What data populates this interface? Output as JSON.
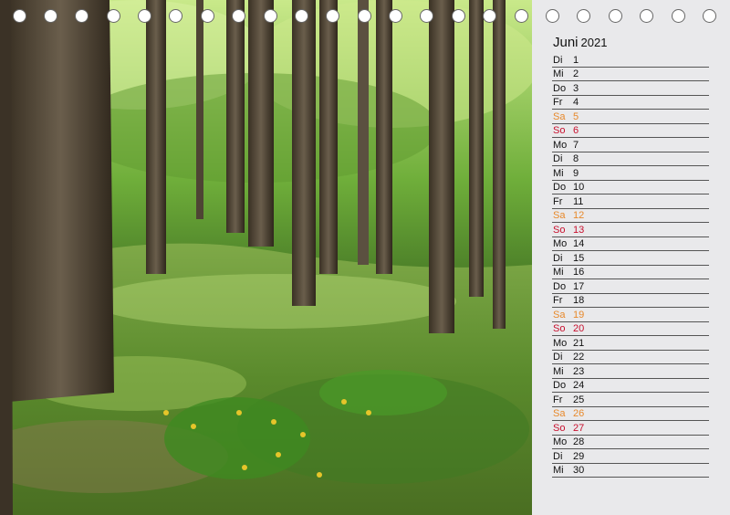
{
  "colors": {
    "saturday": "#e8892b",
    "sunday": "#c8102e",
    "panel_background": "#e9e9eb",
    "rule_line": "#555555"
  },
  "header": {
    "month": "Juni",
    "year": "2021"
  },
  "days": [
    {
      "wd": "Di",
      "n": "1",
      "type": "weekday"
    },
    {
      "wd": "Mi",
      "n": "2",
      "type": "weekday"
    },
    {
      "wd": "Do",
      "n": "3",
      "type": "weekday"
    },
    {
      "wd": "Fr",
      "n": "4",
      "type": "weekday"
    },
    {
      "wd": "Sa",
      "n": "5",
      "type": "saturday"
    },
    {
      "wd": "So",
      "n": "6",
      "type": "sunday"
    },
    {
      "wd": "Mo",
      "n": "7",
      "type": "weekday"
    },
    {
      "wd": "Di",
      "n": "8",
      "type": "weekday"
    },
    {
      "wd": "Mi",
      "n": "9",
      "type": "weekday"
    },
    {
      "wd": "Do",
      "n": "10",
      "type": "weekday"
    },
    {
      "wd": "Fr",
      "n": "11",
      "type": "weekday"
    },
    {
      "wd": "Sa",
      "n": "12",
      "type": "saturday"
    },
    {
      "wd": "So",
      "n": "13",
      "type": "sunday"
    },
    {
      "wd": "Mo",
      "n": "14",
      "type": "weekday"
    },
    {
      "wd": "Di",
      "n": "15",
      "type": "weekday"
    },
    {
      "wd": "Mi",
      "n": "16",
      "type": "weekday"
    },
    {
      "wd": "Do",
      "n": "17",
      "type": "weekday"
    },
    {
      "wd": "Fr",
      "n": "18",
      "type": "weekday"
    },
    {
      "wd": "Sa",
      "n": "19",
      "type": "saturday"
    },
    {
      "wd": "So",
      "n": "20",
      "type": "sunday"
    },
    {
      "wd": "Mo",
      "n": "21",
      "type": "weekday"
    },
    {
      "wd": "Di",
      "n": "22",
      "type": "weekday"
    },
    {
      "wd": "Mi",
      "n": "23",
      "type": "weekday"
    },
    {
      "wd": "Do",
      "n": "24",
      "type": "weekday"
    },
    {
      "wd": "Fr",
      "n": "25",
      "type": "weekday"
    },
    {
      "wd": "Sa",
      "n": "26",
      "type": "saturday"
    },
    {
      "wd": "So",
      "n": "27",
      "type": "sunday"
    },
    {
      "wd": "Mo",
      "n": "28",
      "type": "weekday"
    },
    {
      "wd": "Di",
      "n": "29",
      "type": "weekday"
    },
    {
      "wd": "Mi",
      "n": "30",
      "type": "weekday"
    }
  ]
}
